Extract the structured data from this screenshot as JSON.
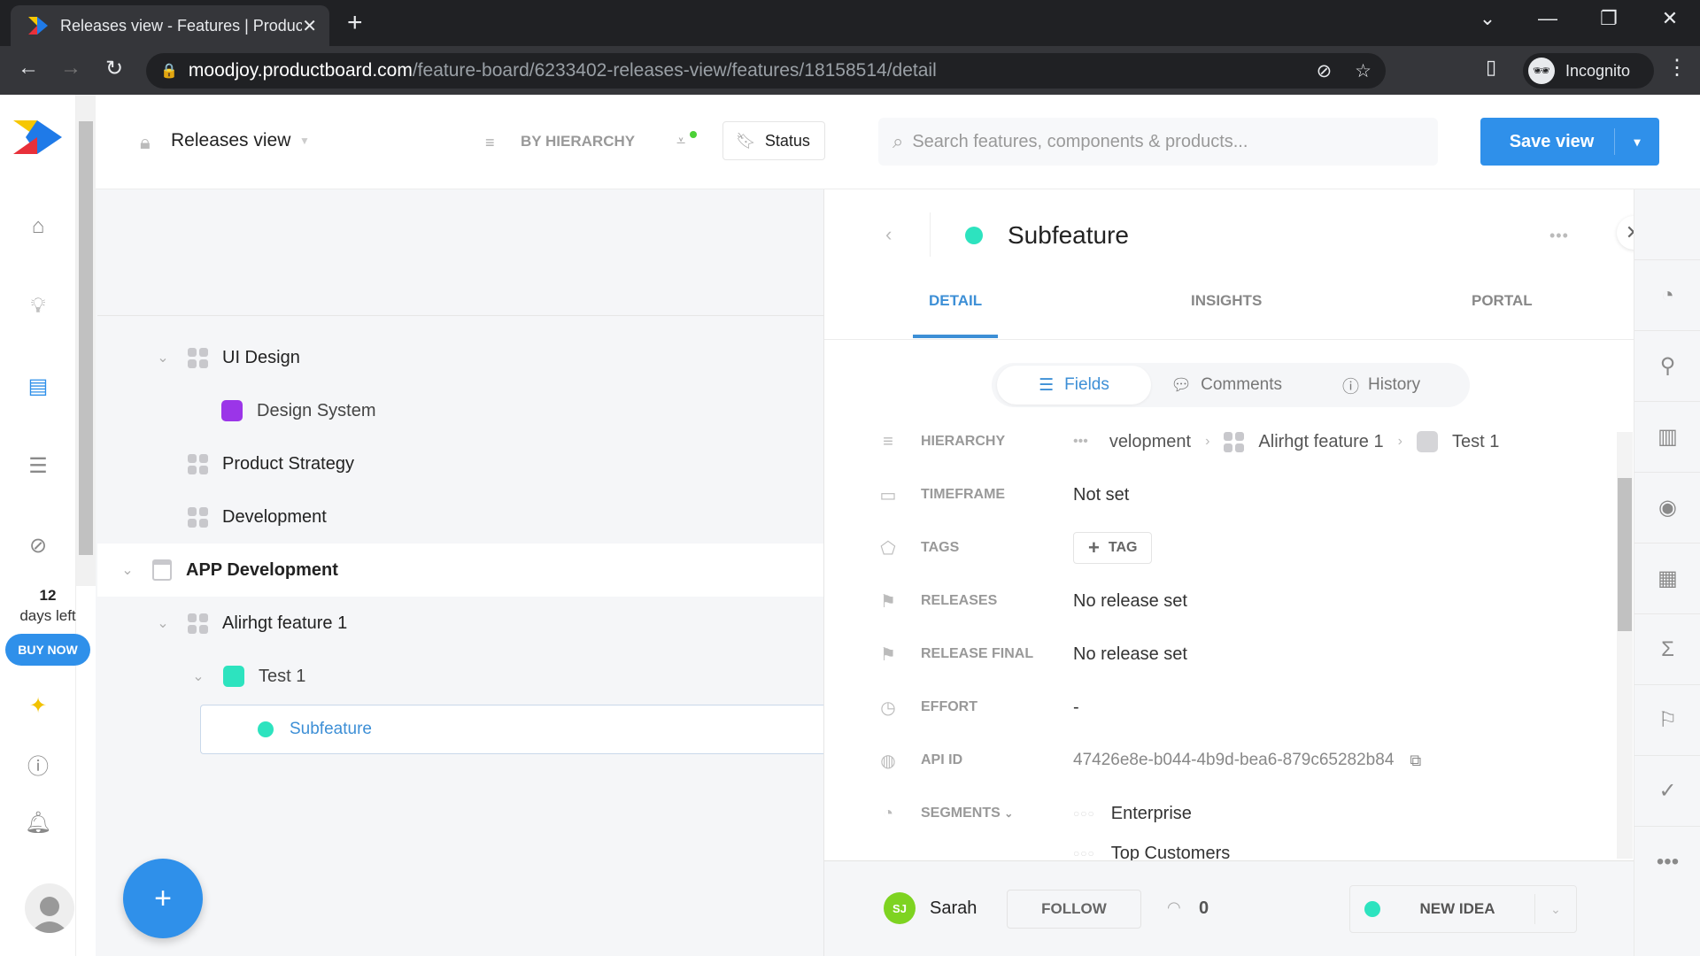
{
  "browser": {
    "tab_title": "Releases view - Features | Productboard",
    "url_host": "moodjoy.productboard.com",
    "url_path": "/feature-board/6233402-releases-view/features/18158514/detail",
    "profile_label": "Incognito"
  },
  "app": {
    "trial_days": "12",
    "trial_label": "days left",
    "buy_now": "BUY NOW",
    "brand_color": "#2f90ea"
  },
  "header": {
    "view_name": "Releases view",
    "grouping": "BY HIERARCHY",
    "status_button": "Status",
    "search_placeholder": "Search features, components & products...",
    "save_view": "Save view"
  },
  "tree": [
    {
      "label": "UI Design",
      "type": "component",
      "level": 1,
      "expanded": true
    },
    {
      "label": "Design System",
      "type": "feature",
      "color": "#9b35e8",
      "level": 2
    },
    {
      "label": "Product Strategy",
      "type": "component",
      "level": 1
    },
    {
      "label": "Development",
      "type": "component",
      "level": 1
    },
    {
      "label": "APP Development",
      "type": "product",
      "level": 0,
      "expanded": true
    },
    {
      "label": "Alirhgt feature 1",
      "type": "component",
      "level": 1,
      "expanded": true
    },
    {
      "label": "Test 1",
      "type": "feature",
      "color": "#2de3bf",
      "level": 2,
      "expanded": true
    },
    {
      "label": "Subfeature",
      "type": "subfeature",
      "color": "#2de3bf",
      "level": 3,
      "selected": true
    }
  ],
  "detail": {
    "title": "Subfeature",
    "status_color": "#2de3bf",
    "tabs": [
      "DETAIL",
      "INSIGHTS",
      "PORTAL"
    ],
    "active_tab": "DETAIL",
    "subtabs": [
      "Fields",
      "Comments",
      "History"
    ],
    "active_subtab": "Fields",
    "fields": {
      "hierarchy_label": "HIERARCHY",
      "hierarchy_path": [
        "velopment",
        "Alirhgt feature 1",
        "Test 1"
      ],
      "timeframe_label": "TIMEFRAME",
      "timeframe_value": "Not set",
      "tags_label": "TAGS",
      "tag_button": "TAG",
      "releases_label": "RELEASES",
      "releases_value": "No release set",
      "release_final_label": "RELEASE FINAL",
      "release_final_value": "No release set",
      "effort_label": "EFFORT",
      "effort_value": "-",
      "api_id_label": "API ID",
      "api_id_value": "47426e8e-b044-4b9d-bea6-879c65282b84",
      "segments_label": "SEGMENTS",
      "segments": [
        "Enterprise",
        "Top Customers"
      ]
    },
    "footer": {
      "owner_initials": "SJ",
      "owner_name": "Sarah",
      "follow": "FOLLOW",
      "followers_count": "0",
      "status": "NEW IDEA"
    }
  }
}
